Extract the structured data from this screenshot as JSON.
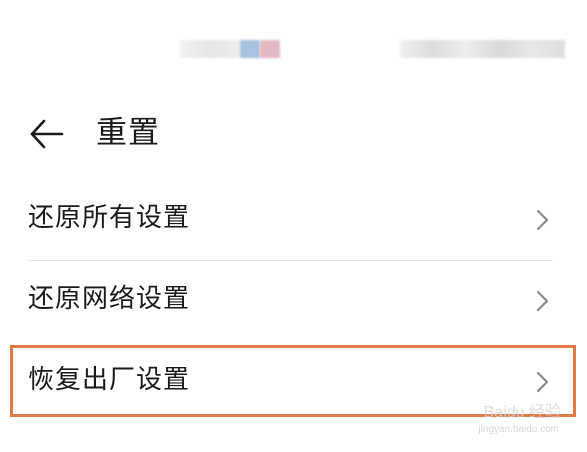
{
  "header": {
    "title": "重置",
    "back_icon": "arrow-left-icon"
  },
  "settings_list": {
    "items": [
      {
        "label": "还原所有设置",
        "icon": "chevron-right-icon"
      },
      {
        "label": "还原网络设置",
        "icon": "chevron-right-icon"
      },
      {
        "label": "恢复出厂设置",
        "icon": "chevron-right-icon",
        "highlighted": true
      }
    ]
  },
  "highlight": {
    "color": "#e07a44"
  },
  "watermark": {
    "main": "Baidu 经验",
    "sub": "jingyan.baidu.com"
  }
}
